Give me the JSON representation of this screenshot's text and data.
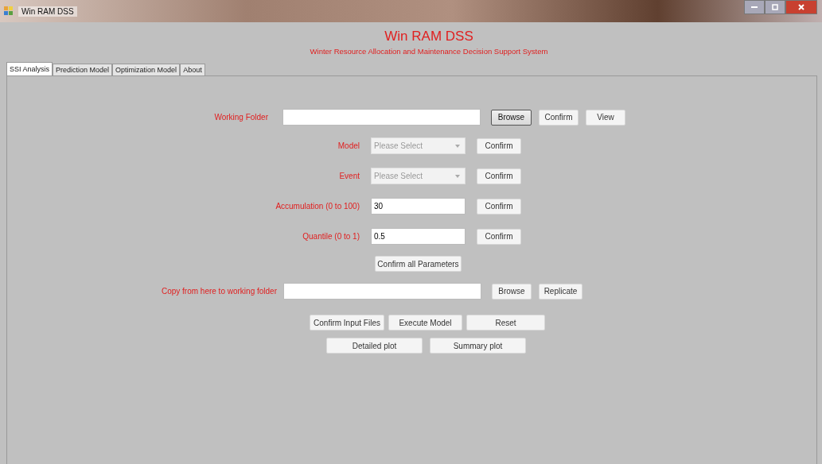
{
  "window": {
    "title": "Win RAM DSS"
  },
  "header": {
    "title": "Win RAM DSS",
    "subtitle": "Winter Resource Allocation and Maintenance Decision Support System"
  },
  "tabs": [
    {
      "label": "SSI Analysis",
      "selected": true
    },
    {
      "label": "Prediction Model",
      "selected": false
    },
    {
      "label": "Optimization Model",
      "selected": false
    },
    {
      "label": "About",
      "selected": false
    }
  ],
  "working_folder": {
    "label": "Working Folder",
    "buttons": [
      {
        "label": "Browse",
        "focused": true
      },
      {
        "label": "Confirm",
        "focused": false
      },
      {
        "label": "View",
        "focused": false
      }
    ]
  },
  "parameters": [
    {
      "label": "Model",
      "kind": "combo",
      "value": "Please Select",
      "button": "Confirm"
    },
    {
      "label": "Event",
      "kind": "combo",
      "value": "Please Select",
      "button": "Confirm"
    },
    {
      "label": "Accumulation (0 to 100)",
      "kind": "text",
      "value": "30",
      "button": "Confirm"
    },
    {
      "label": "Quantile (0 to 1)",
      "kind": "text",
      "value": "0.5",
      "button": "Confirm"
    }
  ],
  "confirm_all": "Confirm all Parameters",
  "copy_folder": {
    "label": "Copy from here to working folder",
    "buttons": [
      {
        "label": "Browse",
        "focused": false
      },
      {
        "label": "Replicate",
        "focused": false
      }
    ]
  },
  "actions": [
    "Confirm Input Files",
    "Execute Model",
    "Reset"
  ],
  "plots": [
    "Detailed plot",
    "Summary plot"
  ]
}
